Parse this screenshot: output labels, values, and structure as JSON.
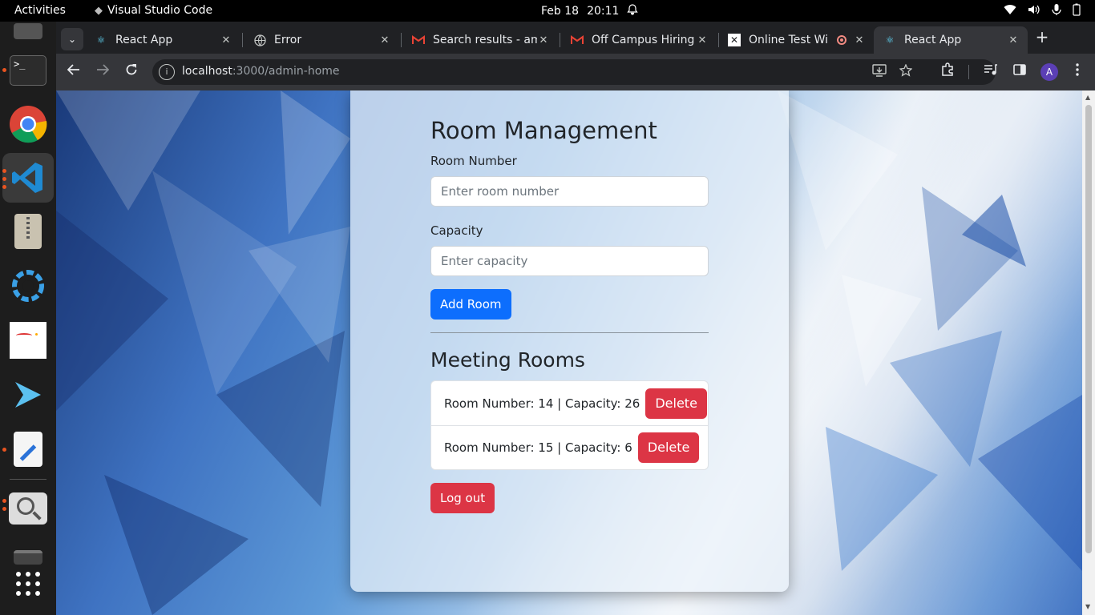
{
  "topbar": {
    "activities": "Activities",
    "app_name": "Visual Studio Code",
    "date": "Feb 18",
    "time": "20:11"
  },
  "browser": {
    "tabs": [
      {
        "title": "React App",
        "icon": "react-icon"
      },
      {
        "title": "Error",
        "icon": "globe-icon"
      },
      {
        "title": "Search results - am",
        "icon": "gmail-icon"
      },
      {
        "title": "Off Campus Hiring",
        "icon": "gmail-icon"
      },
      {
        "title": "Online Test Wi",
        "icon": "test-site-icon"
      },
      {
        "title": "React App",
        "icon": "react-icon",
        "active": true
      }
    ],
    "url_host": "localhost",
    "url_rest": ":3000/admin-home",
    "profile_initial": "A"
  },
  "page": {
    "title": "Room Management",
    "room_number_label": "Room Number",
    "room_number_placeholder": "Enter room number",
    "capacity_label": "Capacity",
    "capacity_placeholder": "Enter capacity",
    "add_button": "Add Room",
    "rooms_heading": "Meeting Rooms",
    "rooms": [
      {
        "text": "Room Number: 14 | Capacity: 26",
        "delete": "Delete"
      },
      {
        "text": "Room Number: 15 | Capacity: 6",
        "delete": "Delete"
      }
    ],
    "logout_button": "Log out"
  },
  "colors": {
    "primary": "#0d6efd",
    "danger": "#dc3545",
    "chrome_dark": "#202124",
    "chrome_toolbar": "#35363a",
    "ubuntu_accent": "#e95420"
  }
}
